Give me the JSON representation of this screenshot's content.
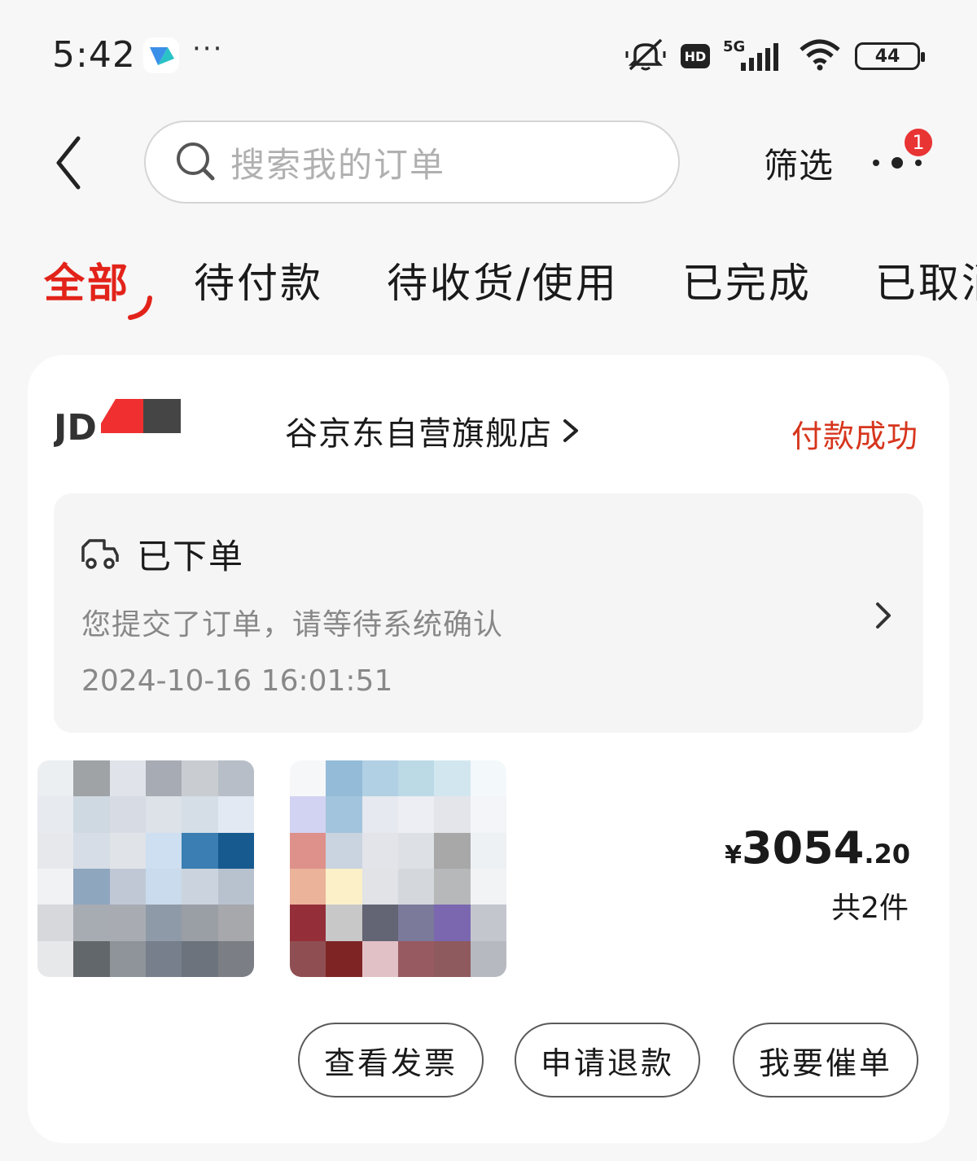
{
  "status_bar": {
    "time": "5:42",
    "more": "···",
    "network": "5G",
    "hd": "HD",
    "battery": "44"
  },
  "header": {
    "search_placeholder": "搜索我的订单",
    "filter_label": "筛选",
    "notification_count": "1"
  },
  "tabs": [
    {
      "label": "全部",
      "active": true
    },
    {
      "label": "待付款"
    },
    {
      "label": "待收货/使用"
    },
    {
      "label": "已完成"
    },
    {
      "label": "已取消"
    }
  ],
  "order": {
    "store_name": "谷京东自营旗舰店",
    "status": "付款成功",
    "tracking": {
      "title": "已下单",
      "message": "您提交了订单，请等待系统确认",
      "time": "2024-10-16 16:01:51"
    },
    "price": {
      "currency": "¥",
      "integer": "3054",
      "decimal": ".20"
    },
    "item_count": "共2件",
    "actions": [
      "查看发票",
      "申请退款",
      "我要催单"
    ]
  },
  "colors": {
    "accent": "#e2231a",
    "status_red": "#d6361d",
    "badge": "#e93434"
  }
}
